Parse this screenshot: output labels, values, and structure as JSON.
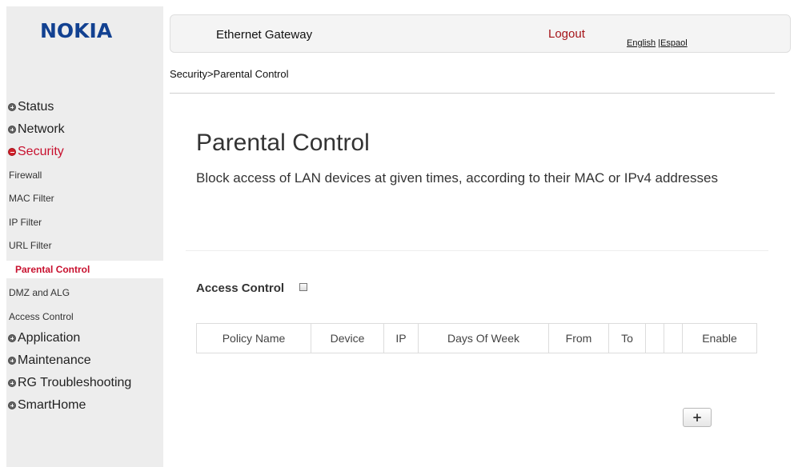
{
  "brand": {
    "logo_text": "NOKIA",
    "color": "#124191"
  },
  "header": {
    "title": "Ethernet Gateway",
    "logout_label": "Logout",
    "lang_english": "English",
    "lang_separator": " |",
    "lang_spanish": "Espaol"
  },
  "breadcrumb": "Security>Parental Control",
  "sidebar": {
    "status": "Status",
    "network": "Network",
    "security": "Security",
    "security_items": [
      "Firewall",
      "MAC Filter",
      "IP Filter",
      "URL Filter",
      "Parental Control",
      "DMZ and ALG",
      "Access Control"
    ],
    "application": "Application",
    "maintenance": "Maintenance",
    "rg_troubleshooting": "RG Troubleshooting",
    "smarthome": "SmartHome"
  },
  "main": {
    "title": "Parental Control",
    "description": "Block access of LAN devices at given times, according to their MAC or IPv4 addresses",
    "access_control_label": "Access Control",
    "access_control_checked": false,
    "table_headers": [
      "Policy Name",
      "Device",
      "IP",
      "Days Of Week",
      "From",
      "To",
      "",
      "",
      "Enable"
    ],
    "add_button_label": "+"
  },
  "colors": {
    "accent_red": "#c8102e",
    "logout_red": "#a51419",
    "sidebar_bg": "#ededed"
  }
}
